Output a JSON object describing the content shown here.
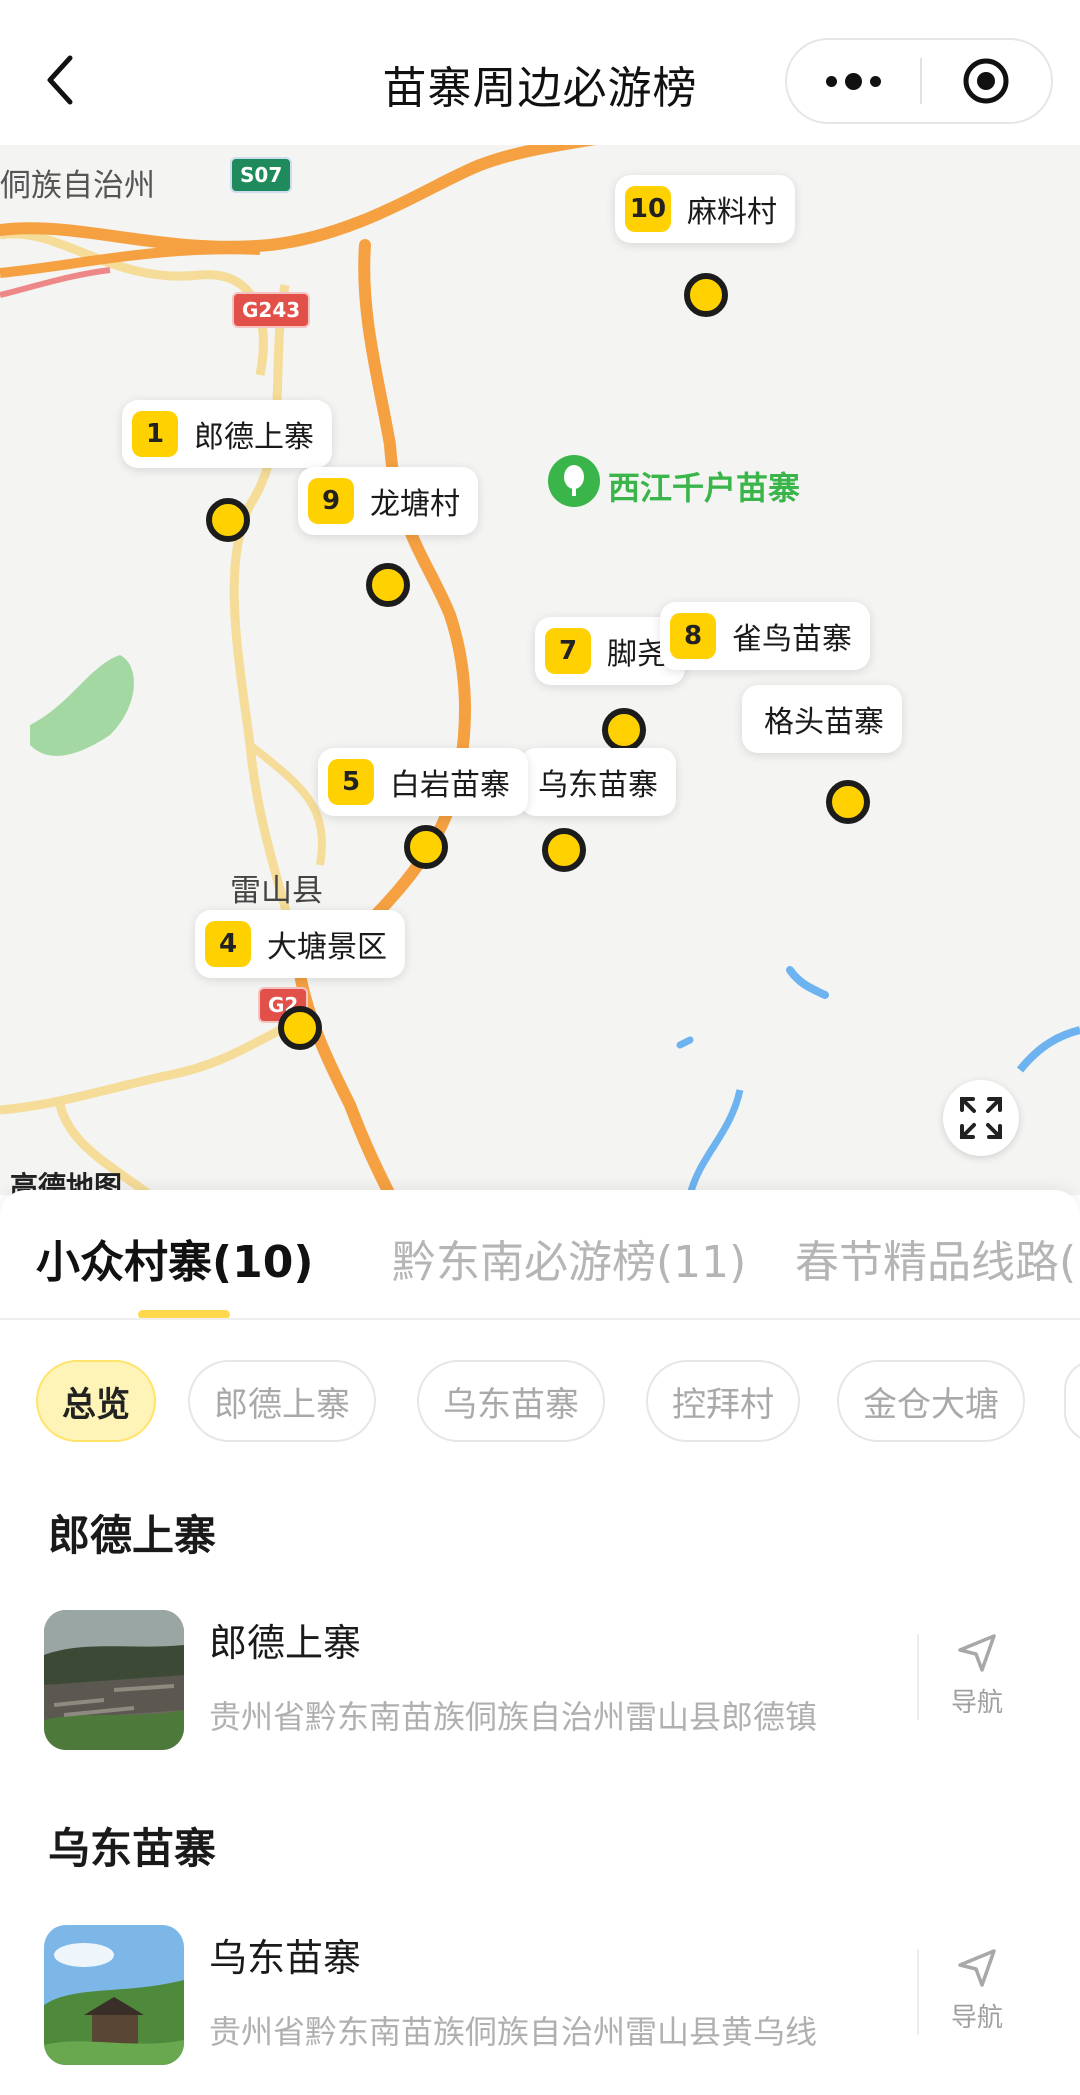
{
  "header": {
    "title": "苗寨周边必游榜"
  },
  "map": {
    "labels": {
      "prefecture": "侗族自治州",
      "xijiang": "西江千户苗寨",
      "leishan": "雷山县"
    },
    "road_badges": {
      "s07": "S07",
      "g243": "G243",
      "g2": "G2"
    },
    "pins": [
      {
        "num": "10",
        "name": "麻料村"
      },
      {
        "num": "1",
        "name": "郎德上寨"
      },
      {
        "num": "9",
        "name": "龙塘村"
      },
      {
        "num": "7",
        "name": "脚尧"
      },
      {
        "num": "8",
        "name": "雀鸟苗寨"
      },
      {
        "num": "",
        "name": "格头苗寨"
      },
      {
        "num": "5",
        "name": "白岩苗寨"
      },
      {
        "num": "",
        "name": "乌东苗寨"
      },
      {
        "num": "4",
        "name": "大塘景区"
      }
    ],
    "credit": "高德地图"
  },
  "tabs": [
    {
      "label": "小众村寨(10)",
      "active": true
    },
    {
      "label": "黔东南必游榜(11)",
      "active": false
    },
    {
      "label": "春节精品线路(",
      "active": false
    }
  ],
  "chips": [
    {
      "label": "总览",
      "active": true
    },
    {
      "label": "郎德上寨",
      "active": false
    },
    {
      "label": "乌东苗寨",
      "active": false
    },
    {
      "label": "控拜村",
      "active": false
    },
    {
      "label": "金仓大塘",
      "active": false
    }
  ],
  "sections": [
    {
      "title": "郎德上寨",
      "poi": {
        "name": "郎德上寨",
        "address": "贵州省黔东南苗族侗族自治州雷山县郎德镇",
        "nav_label": "导航"
      }
    },
    {
      "title": "乌东苗寨",
      "poi": {
        "name": "乌东苗寨",
        "address": "贵州省黔东南苗族侗族自治州雷山县黄乌线",
        "nav_label": "导航"
      }
    }
  ],
  "colors": {
    "accent_yellow": "#ffd100",
    "tab_indicator": "#ffd84d",
    "chip_active_bg": "#fff4b8",
    "road_orange": "#f5a142",
    "xijiang_green": "#39b54a"
  }
}
